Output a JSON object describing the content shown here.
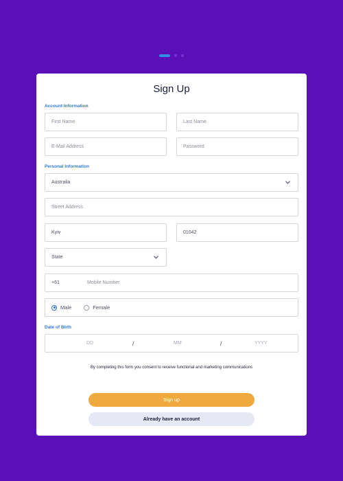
{
  "form": {
    "title": "Sign Up",
    "account_section": "Account Information",
    "personal_section": "Personal Information",
    "dob_section": "Date of Birth",
    "first_name_placeholder": "First Name",
    "last_name_placeholder": "Last Name",
    "email_placeholder": "E-Mail Address",
    "password_placeholder": "Password",
    "country_value": "Australia",
    "street_placeholder": "Street Address",
    "city_value": "Kyiv",
    "zip_value": "01042",
    "state_value": "State",
    "phone_prefix": "+61",
    "mobile_placeholder": "Mobile Number",
    "gender_male": "Male",
    "gender_female": "Female",
    "gender_selected": "Male",
    "dob_day": "DD",
    "dob_month": "MM",
    "dob_year": "YYYY",
    "dob_separator": "/",
    "consent_text": "By completing this form you consent to receive functional and marketing communications",
    "signup_button": "Sign up",
    "account_button": "Already have an account"
  },
  "pager": {
    "total": 3,
    "active_index": 0
  },
  "colors": {
    "background": "#5b0fb6",
    "accent": "#2f7ad9",
    "primary_button": "#f0a93f",
    "secondary_button": "#e6e9f3"
  },
  "icons": {
    "dropdown": "chevron-down-icon"
  }
}
